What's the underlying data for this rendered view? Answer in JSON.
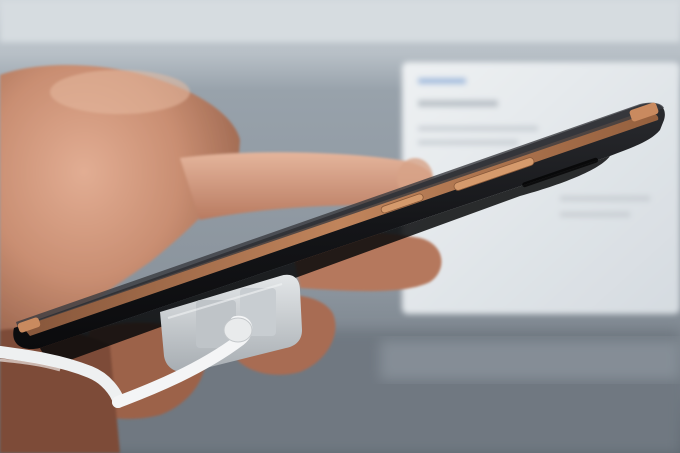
{
  "scene": {
    "description_tags": [
      "hand-icon",
      "smartphone-icon",
      "security-cable-icon"
    ],
    "colors": {
      "background_top": "#c9d0d6",
      "background_mid": "#8e98a1",
      "background_bottom": "#5e6770",
      "card": "#dfe4e8",
      "skin_light": "#d9a48a",
      "skin_dark": "#8a5540",
      "phone_body": "#1c1d20",
      "phone_trim": "#b9774f",
      "mount": "#cfd3d6",
      "cable": "#f2f3f4"
    }
  }
}
